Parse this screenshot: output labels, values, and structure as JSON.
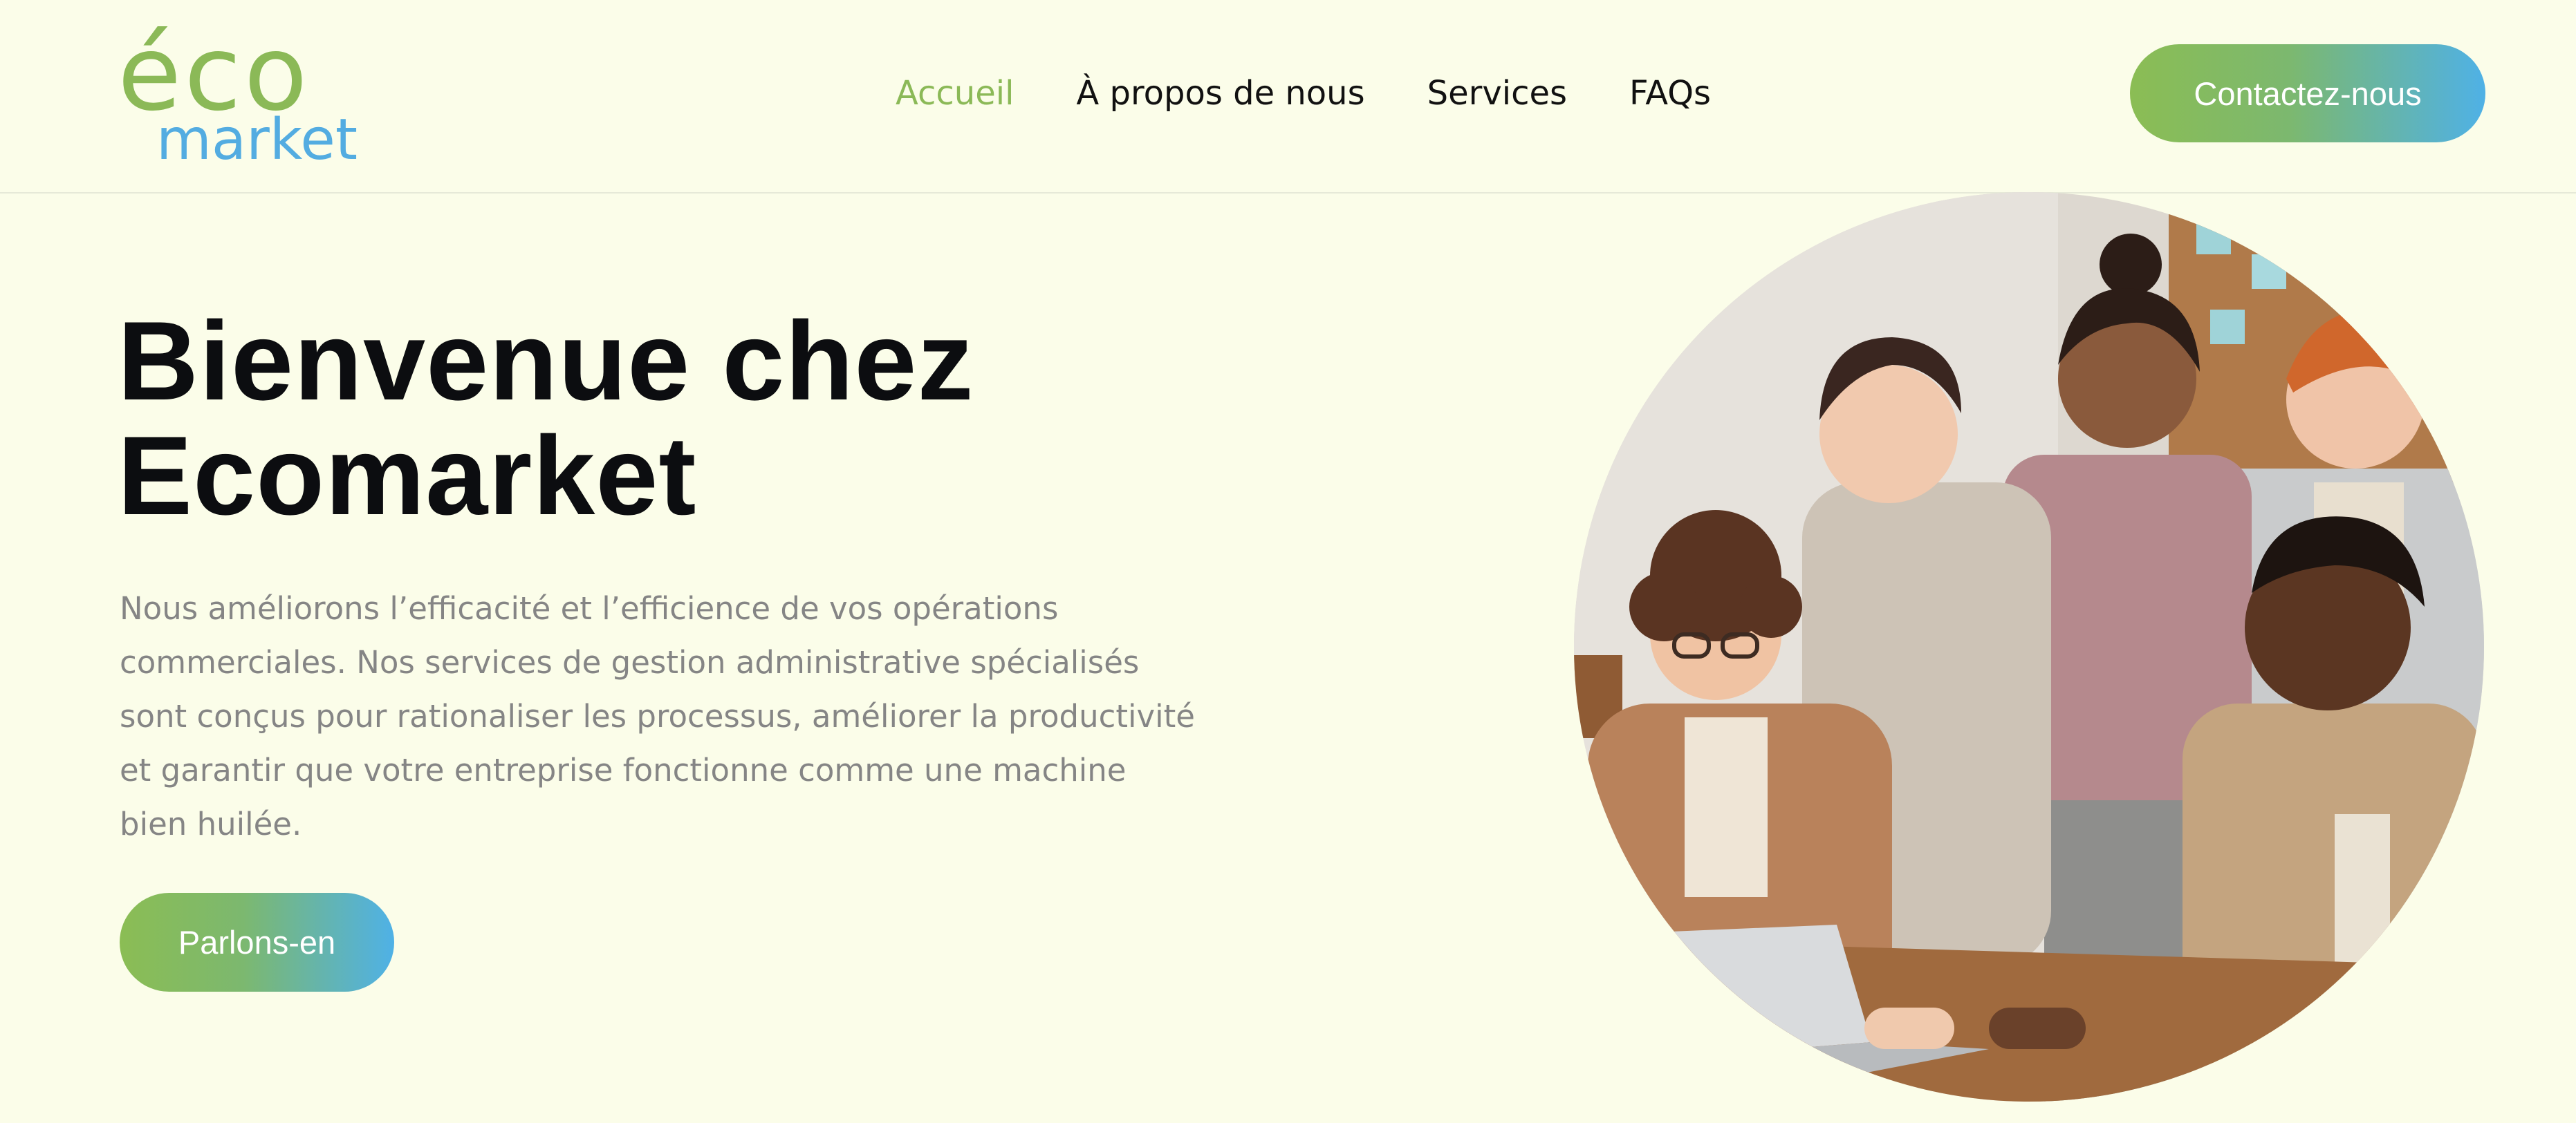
{
  "brand": {
    "logo_top": "éco",
    "logo_bottom": "market",
    "colors": {
      "green": "#8bb957",
      "blue": "#53ace1",
      "background": "#fbfde9",
      "heading": "#0c0d10",
      "body_text": "#858585"
    }
  },
  "nav": {
    "items": [
      {
        "label": "Accueil",
        "active": true
      },
      {
        "label": "À propos de nous",
        "active": false
      },
      {
        "label": "Services",
        "active": false
      },
      {
        "label": "FAQs",
        "active": false
      }
    ],
    "contact_label": "Contactez-nous"
  },
  "hero": {
    "title_line1": "Bienvenue chez",
    "title_line2": "Ecomarket",
    "description": "Nous améliorons l’efficacité et l’efficience de vos opérations commerciales. Nos services de gestion administrative spécialisés sont conçus pour rationaliser les processus, améliorer la productivité et garantir que votre entreprise fonctionne comme une machine bien huilée.",
    "cta_label": "Parlons-en",
    "image_icon": "team-photo-image"
  }
}
